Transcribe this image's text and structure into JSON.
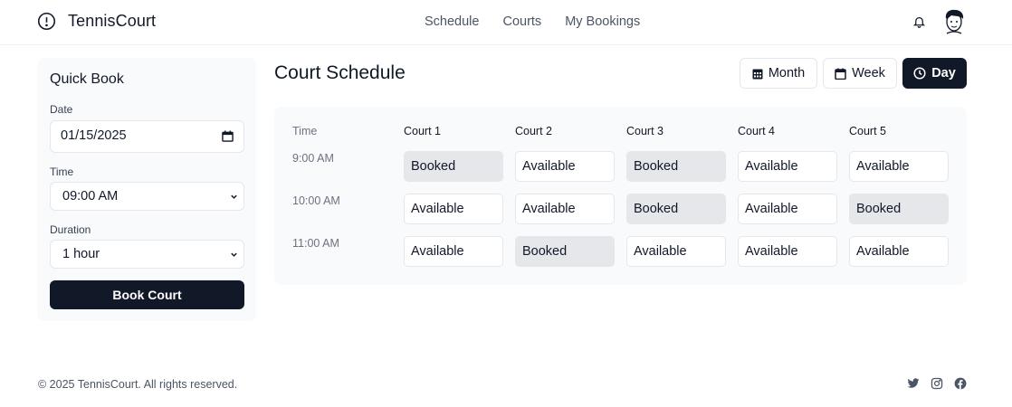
{
  "header": {
    "brand": "TennisCourt",
    "nav": [
      {
        "label": "Schedule"
      },
      {
        "label": "Courts"
      },
      {
        "label": "My Bookings"
      }
    ],
    "icons": {
      "brand": "alert-circle-icon",
      "notifications": "bell-icon",
      "avatar": "user-avatar"
    }
  },
  "quick_book": {
    "title": "Quick Book",
    "date_label": "Date",
    "date_value": "01/15/2025",
    "time_label": "Time",
    "time_value": "09:00 AM",
    "duration_label": "Duration",
    "duration_value": "1 hour",
    "button_label": "Book Court"
  },
  "schedule": {
    "title": "Court Schedule",
    "views": [
      {
        "label": "Month",
        "icon": "calendar-grid-icon",
        "active": false
      },
      {
        "label": "Week",
        "icon": "calendar-icon",
        "active": false
      },
      {
        "label": "Day",
        "icon": "clock-icon",
        "active": true
      }
    ],
    "time_header": "Time",
    "courts": [
      "Court 1",
      "Court 2",
      "Court 3",
      "Court 4",
      "Court 5"
    ],
    "rows": [
      {
        "time": "9:00 AM",
        "slots": [
          "Booked",
          "Available",
          "Booked",
          "Available",
          "Available"
        ]
      },
      {
        "time": "10:00 AM",
        "slots": [
          "Available",
          "Available",
          "Booked",
          "Available",
          "Booked"
        ]
      },
      {
        "time": "11:00 AM",
        "slots": [
          "Available",
          "Booked",
          "Available",
          "Available",
          "Available"
        ]
      }
    ]
  },
  "footer": {
    "copyright": "© 2025 TennisCourt. All rights reserved.",
    "social": [
      "twitter-icon",
      "instagram-icon",
      "facebook-icon"
    ]
  },
  "colors": {
    "primary": "#111827",
    "booked": "#e5e7eb",
    "card": "#f9fafb"
  }
}
